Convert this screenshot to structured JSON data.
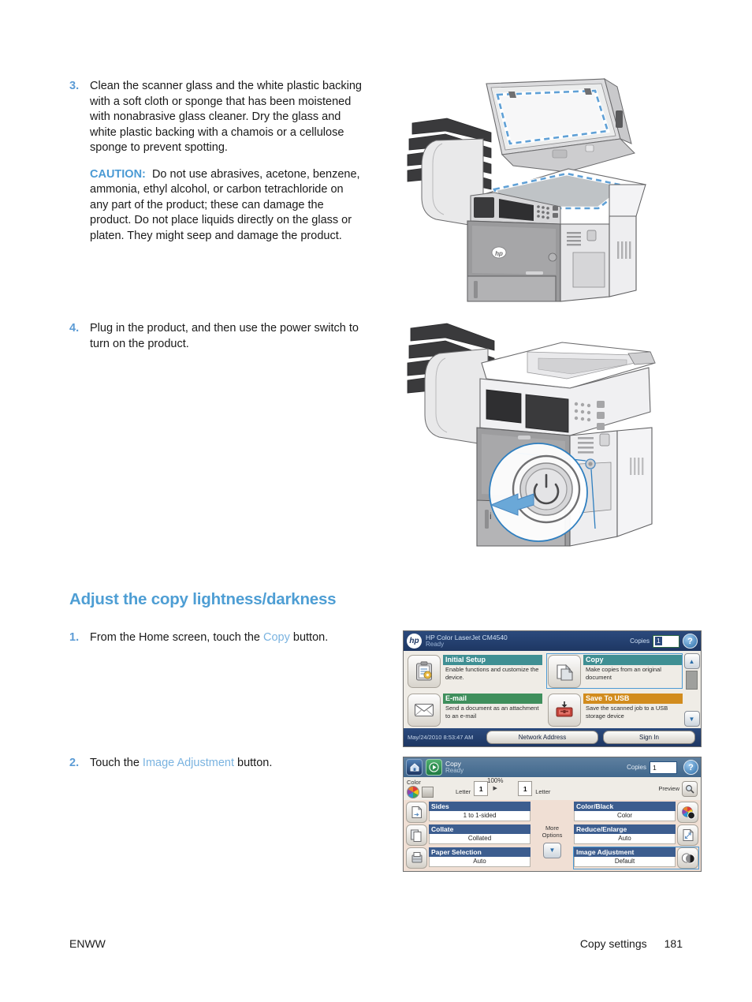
{
  "document": {
    "steps": [
      {
        "number": "3.",
        "paragraph1": "Clean the scanner glass and the white plastic backing with a soft cloth or sponge that has been moistened with nonabrasive glass cleaner. Dry the glass and white plastic backing with a chamois or a cellulose sponge to prevent spotting.",
        "caution_label": "CAUTION:",
        "caution_text": "Do not use abrasives, acetone, benzene, ammonia, ethyl alcohol, or carbon tetrachloride on any part of the product; these can damage the product. Do not place liquids directly on the glass or platen. They might seep and damage the product."
      },
      {
        "number": "4.",
        "paragraph1": "Plug in the product, and then use the power switch to turn on the product."
      }
    ],
    "section_heading": "Adjust the copy lightness/darkness",
    "procedure": [
      {
        "number": "1.",
        "text_before": "From the Home screen, touch the ",
        "ui_ref": "Copy",
        "text_after": " button."
      },
      {
        "number": "2.",
        "text_before": "Touch the ",
        "ui_ref": "Image Adjustment",
        "text_after": " button."
      }
    ],
    "footer": {
      "left": "ENWW",
      "chapter": "Copy settings",
      "page_number": "181"
    }
  },
  "home_screen": {
    "logo_text": "hp",
    "product_name": "HP Color LaserJet CM4540",
    "status": "Ready",
    "copies_label": "Copies",
    "copies_value": "1",
    "help_glyph": "?",
    "tiles": [
      {
        "title": "Initial Setup",
        "description": "Enable functions and customize the device.",
        "color": "teal",
        "icon": "initial-setup-icon",
        "selected": false
      },
      {
        "title": "Copy",
        "description": "Make copies from an original document",
        "color": "teal",
        "icon": "copy-icon",
        "selected": true
      },
      {
        "title": "E-mail",
        "description": "Send a document as an attachment to an e-mail",
        "color": "green",
        "icon": "envelope-icon",
        "selected": false
      },
      {
        "title": "Save To USB",
        "description": "Save the scanned job to a USB storage device",
        "color": "amber",
        "icon": "usb-icon",
        "selected": false
      }
    ],
    "scroll_up_glyph": "▲",
    "scroll_down_glyph": "▼",
    "datetime": "May/24/2010 8:53:47 AM",
    "network_address_button": "Network Address",
    "sign_in_button": "Sign In"
  },
  "copy_screen": {
    "home_icon": "home-icon",
    "start_icon": "start-icon",
    "title": "Copy",
    "status": "Ready",
    "copies_label": "Copies",
    "copies_value": "1",
    "help_glyph": "?",
    "color_label": "Color",
    "source_size": "Letter",
    "source_count": "1",
    "scale_percent": "100%",
    "scale_arrow": "▶",
    "dest_count": "1",
    "dest_size": "Letter",
    "preview_label": "Preview",
    "more_options_line1": "More",
    "more_options_line2": "Options",
    "more_options_glyph": "▼",
    "settings_left": [
      {
        "title": "Sides",
        "value": "1 to 1-sided",
        "icon": "sides-icon",
        "selected": false
      },
      {
        "title": "Collate",
        "value": "Collated",
        "icon": "collate-icon",
        "selected": false
      },
      {
        "title": "Paper Selection",
        "value": "Auto",
        "icon": "paper-selection-icon",
        "selected": false
      }
    ],
    "settings_right": [
      {
        "title": "Color/Black",
        "value": "Color",
        "icon": "color-black-icon",
        "selected": false
      },
      {
        "title": "Reduce/Enlarge",
        "value": "Auto",
        "icon": "reduce-enlarge-icon",
        "selected": false
      },
      {
        "title": "Image Adjustment",
        "value": "Default",
        "icon": "image-adjustment-icon",
        "selected": true
      }
    ]
  },
  "colors": {
    "accent_blue": "#4e9ed4",
    "ui_ref_blue": "#7ab3e0",
    "panel_header_blue": "#1e3763",
    "tile_teal": "#3f8f93",
    "tile_green": "#3f8f5c",
    "tile_amber": "#d28c1e",
    "setting_header": "#3c5d8f",
    "highlight_outline": "#4d9ad4"
  }
}
